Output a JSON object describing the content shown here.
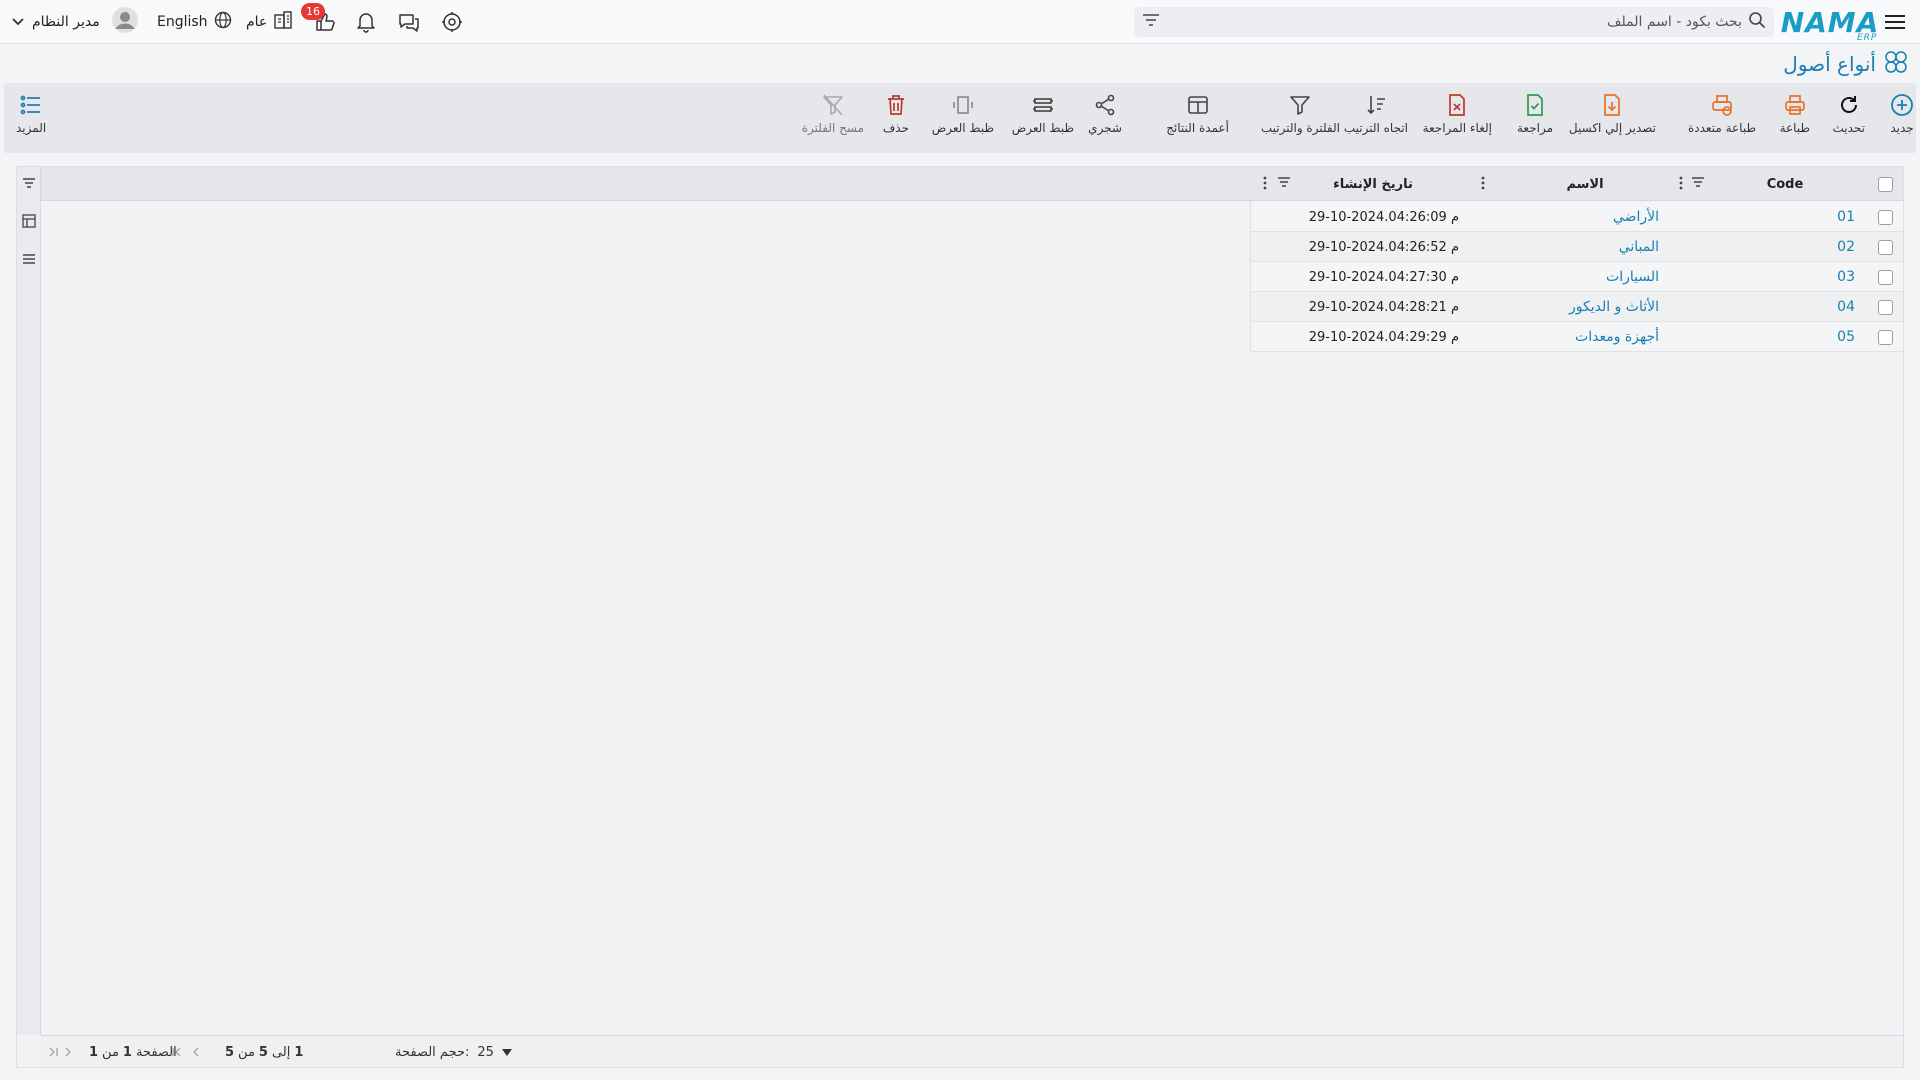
{
  "topbar": {
    "logo_text": "NAMA",
    "logo_sub": "ERP",
    "search_placeholder": "بحث بكود - اسم الملف",
    "notification_count": "16",
    "branch_label": "عام",
    "language_label": "English",
    "user_name": "مدير النظام",
    "icons": [
      "menu-icon",
      "search-icon",
      "filter-icon",
      "settings-icon",
      "chat-icon",
      "bell-icon",
      "like-icon",
      "branch-icon",
      "globe-icon",
      "avatar-icon",
      "chevron-down-icon"
    ]
  },
  "page": {
    "title": "أنواع أصول"
  },
  "toolbar": {
    "new": "جديد",
    "refresh": "تحديث",
    "print": "طباعة",
    "multi_print": "طباعة متعددة",
    "export_excel": "تصدير إلي اكسيل",
    "review": "مراجعة",
    "cancel_review": "إلغاء المراجعة",
    "sort_direction": "اتجاه الترتيب",
    "filter_sort": "الفلترة والترتيب",
    "result_columns": "أعمدة النتائج",
    "tree": "شجري",
    "view_adjust_1": "ظبط العرض",
    "view_adjust_2": "ظبط العرض",
    "delete": "حذف",
    "clear_filter": "مسح الفلترة",
    "more": "المزيد"
  },
  "grid": {
    "columns": {
      "code": "Code",
      "name": "الاسم",
      "created": "تاريخ الإنشاء"
    },
    "rows": [
      {
        "code": "01",
        "name": "الأراضي",
        "created": "29-10-2024.04:26:09 م"
      },
      {
        "code": "02",
        "name": "المباني",
        "created": "29-10-2024.04:26:52 م"
      },
      {
        "code": "03",
        "name": "السيارات",
        "created": "29-10-2024.04:27:30 م"
      },
      {
        "code": "04",
        "name": "الأثاث و الديكور",
        "created": "29-10-2024.04:28:21 م"
      },
      {
        "code": "05",
        "name": "أجهزة ومعدات",
        "created": "29-10-2024.04:29:29 م"
      }
    ]
  },
  "footer": {
    "page_size_label": "حجم الصفحة:",
    "page_size_value": "25",
    "range_from": "1",
    "range_to_label": "إلى",
    "range_to": "5",
    "range_of_label": "من",
    "range_total": "5",
    "page_label": "الصفحة",
    "page_current": "1",
    "page_of_label": "من",
    "page_total": "1"
  }
}
